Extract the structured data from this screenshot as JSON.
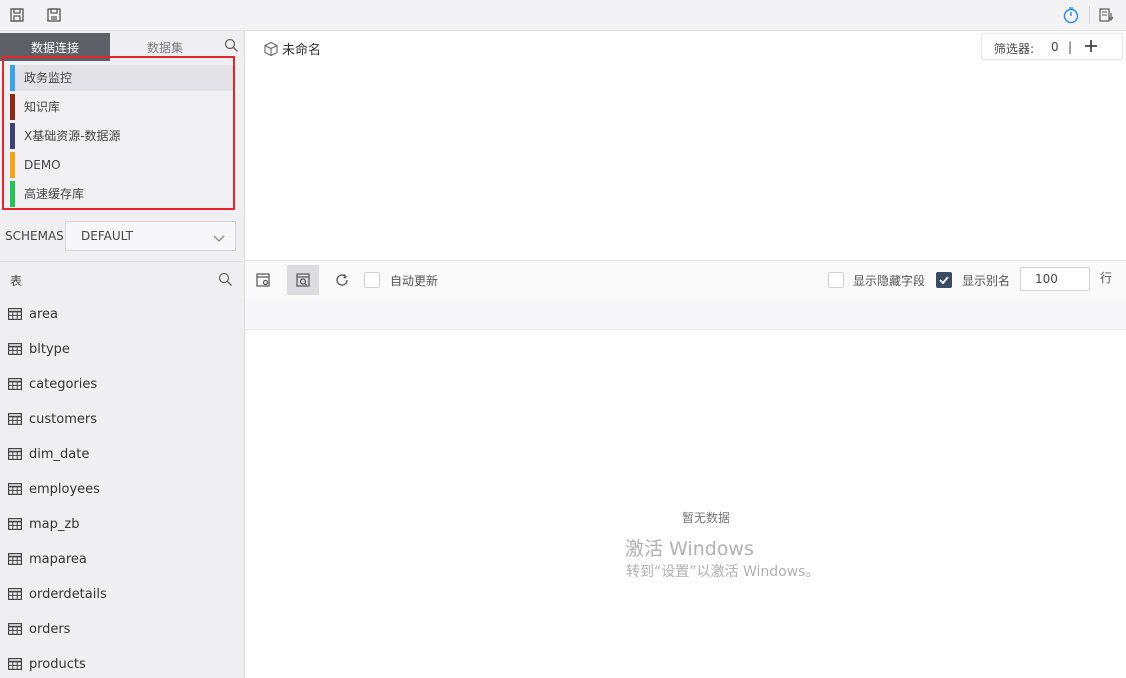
{
  "toolbar": {
    "icons": [
      "save-icon",
      "save-as-icon",
      "timer-icon",
      "export-icon"
    ],
    "accent": "#2d8cf0"
  },
  "left": {
    "tabs": [
      {
        "label": "数据连接",
        "active": true
      },
      {
        "label": "数据集",
        "active": false
      }
    ],
    "connections": [
      {
        "label": "政务监控",
        "color": "#3ca3e8",
        "selected": true
      },
      {
        "label": "知识库",
        "color": "#8b2a14",
        "selected": false
      },
      {
        "label": "X基础资源-数据源",
        "color": "#3f3f78",
        "selected": false
      },
      {
        "label": "DEMO",
        "color": "#f0a41c",
        "selected": false
      },
      {
        "label": "高速缓存库",
        "color": "#25c25a",
        "selected": false
      }
    ],
    "schemas_label": "SCHEMAS",
    "schema_value": "DEFAULT",
    "tables_title": "表",
    "tables": [
      "area",
      "bltype",
      "categories",
      "customers",
      "dim_date",
      "employees",
      "map_zb",
      "maparea",
      "orderdetails",
      "orders",
      "products"
    ]
  },
  "main": {
    "dataset_name": "未命名",
    "filter_label": "筛选器:",
    "filter_count": "0",
    "filter_divider": "|",
    "auto_update_label": "自动更新",
    "auto_update_checked": false,
    "show_hidden_label": "显示隐藏字段",
    "show_hidden_checked": false,
    "show_alias_label": "显示别名",
    "show_alias_checked": true,
    "row_limit": "100",
    "row_unit": "行",
    "empty_text": "暂无数据"
  },
  "watermark": {
    "line1": "激活 Windows",
    "line2": "转到“设置”以激活 Windows。"
  }
}
